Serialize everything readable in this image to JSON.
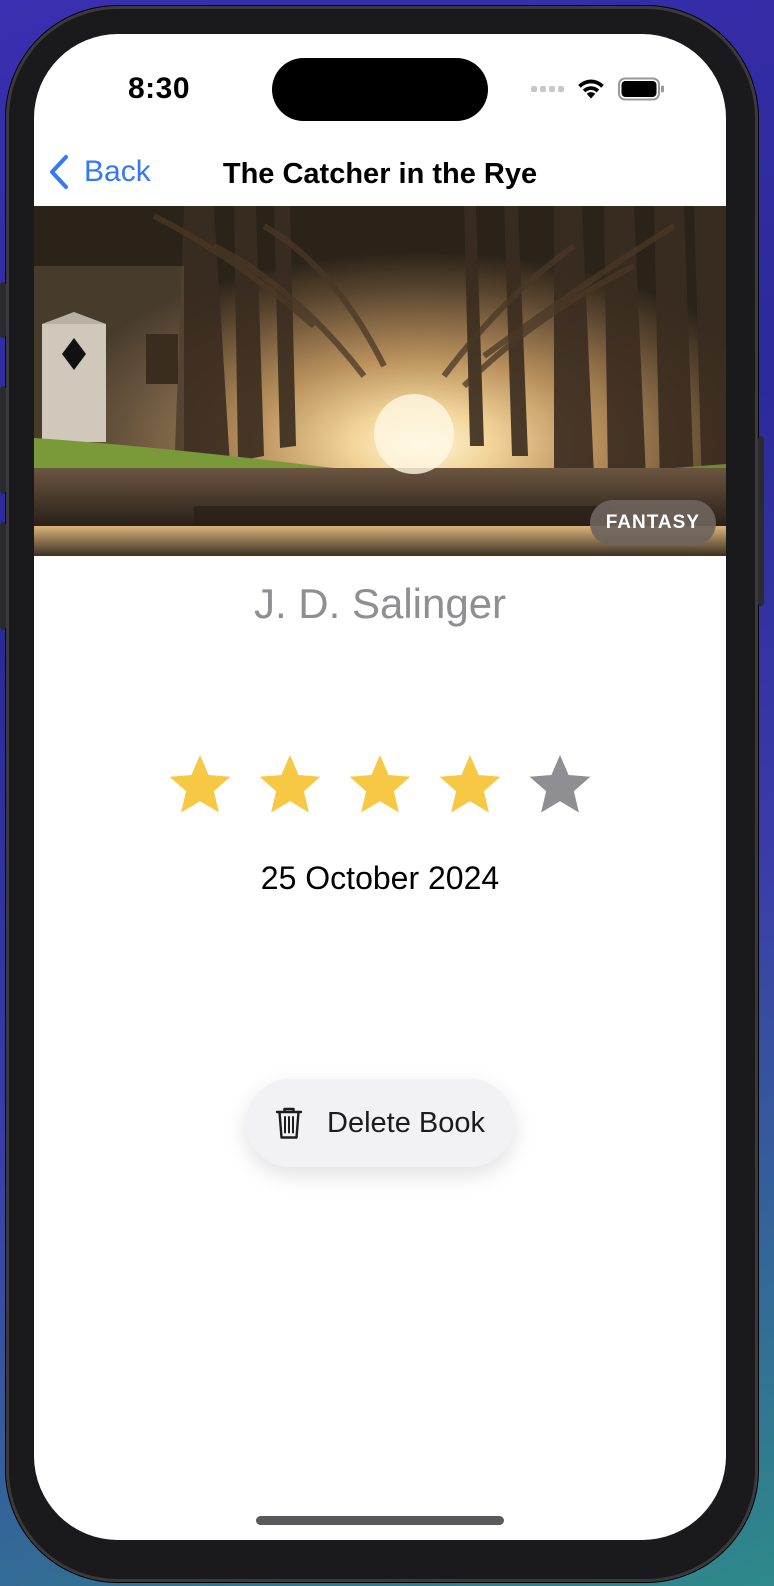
{
  "status_bar": {
    "time": "8:30",
    "signal_icon": "cellular-dots-icon",
    "wifi_icon": "wifi-icon",
    "battery_icon": "battery-icon"
  },
  "nav": {
    "back_label": "Back",
    "back_icon": "chevron-left-icon",
    "title": "The Catcher in the Rye"
  },
  "book": {
    "cover_image": "misty-forest-path-photo",
    "genre": "FANTASY",
    "author": "J. D. Salinger",
    "rating": 4,
    "rating_max": 5,
    "date": "25 October 2024"
  },
  "actions": {
    "delete_label": "Delete Book",
    "delete_icon": "trash-icon"
  },
  "colors": {
    "accent": "#3478f6",
    "star_filled": "#f7c844",
    "star_empty": "#8e8e93",
    "genre_badge": "#6e645c"
  }
}
